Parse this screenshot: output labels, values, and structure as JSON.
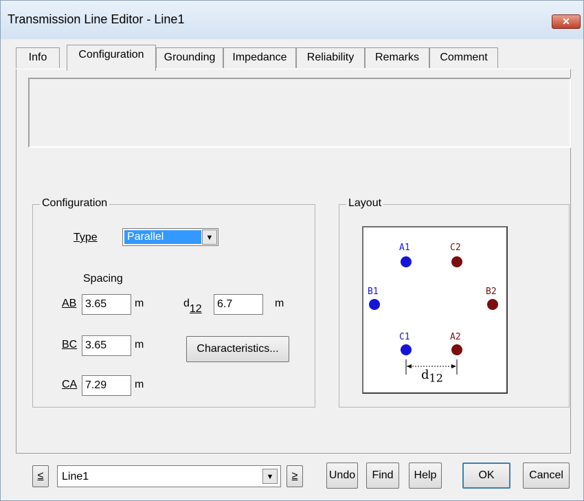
{
  "window": {
    "title": "Transmission Line Editor - Line1",
    "close_icon": "✕"
  },
  "tabs": [
    {
      "label": "Info",
      "active": false
    },
    {
      "label": "Configuration",
      "active": true
    },
    {
      "label": "Grounding",
      "active": false
    },
    {
      "label": "Impedance",
      "active": false
    },
    {
      "label": "Reliability",
      "active": false
    },
    {
      "label": "Remarks",
      "active": false
    },
    {
      "label": "Comment",
      "active": false
    }
  ],
  "configuration": {
    "group_label": "Configuration",
    "type_label": "Type",
    "type_value": "Parallel",
    "spacing_label": "Spacing",
    "ab_label": "AB",
    "ab_value": "3.65",
    "bc_label": "BC",
    "bc_value": "3.65",
    "ca_label": "CA",
    "ca_value": "7.29",
    "unit": "m",
    "d_label": "d",
    "d_sub": "12",
    "d12_value": "6.7",
    "characteristics_button": "Characteristics..."
  },
  "layout": {
    "group_label": "Layout",
    "a1": "A1",
    "b1": "B1",
    "c1": "C1",
    "a2": "A2",
    "b2": "B2",
    "c2": "C2",
    "dim_label": "d",
    "dim_sub": "12",
    "colors": {
      "circuit1": "#1515d8",
      "circuit2": "#7a0d0d"
    }
  },
  "footer": {
    "prev": "≤",
    "line_value": "Line1",
    "next": "≥",
    "undo": "Undo",
    "find": "Find",
    "help": "Help",
    "ok": "OK",
    "cancel": "Cancel"
  }
}
